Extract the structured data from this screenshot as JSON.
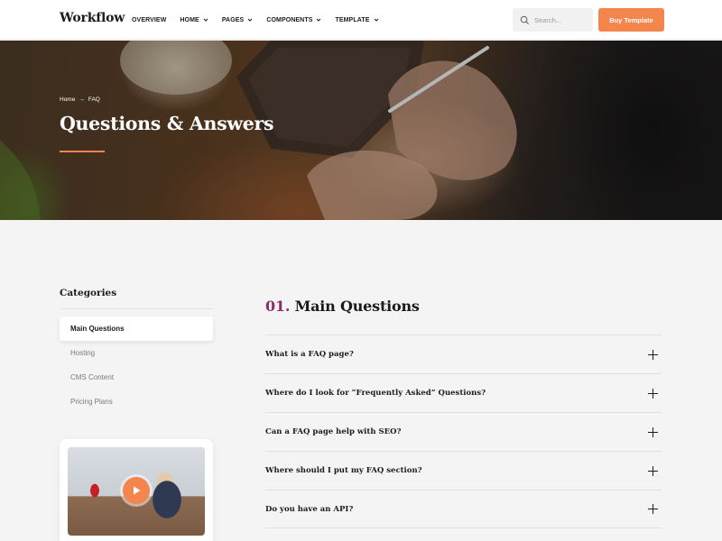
{
  "header": {
    "logo": "Workflow",
    "nav": [
      {
        "label": "OVERVIEW",
        "has_dropdown": false
      },
      {
        "label": "HOME",
        "has_dropdown": true
      },
      {
        "label": "PAGES",
        "has_dropdown": true
      },
      {
        "label": "COMPONENTS",
        "has_dropdown": true
      },
      {
        "label": "TEMPLATE",
        "has_dropdown": true
      }
    ],
    "search_placeholder": "Search...",
    "buy_label": "Buy Template"
  },
  "hero": {
    "breadcrumb": {
      "home": "Home",
      "separator": "→",
      "current": "FAQ"
    },
    "title": "Questions & Answers"
  },
  "sidebar": {
    "title": "Categories",
    "items": [
      {
        "label": "Main Questions",
        "active": true
      },
      {
        "label": "Hosting",
        "active": false
      },
      {
        "label": "CMS Content",
        "active": false
      },
      {
        "label": "Pricing Plans",
        "active": false
      }
    ]
  },
  "main": {
    "section_number": "01.",
    "section_title": "Main Questions",
    "faqs": [
      {
        "question": "What is a FAQ page?"
      },
      {
        "question": "Where do I look for “Frequently Asked” Questions?"
      },
      {
        "question": "Can a FAQ page help with SEO?"
      },
      {
        "question": "Where should I put my FAQ section?"
      },
      {
        "question": "Do you have an API?"
      }
    ]
  },
  "colors": {
    "accent": "#f4854c",
    "section_number": "#8a2e6b",
    "page_background": "#f4f4f4"
  },
  "icons": {
    "search": "search-icon",
    "dropdown": "chevron-down-icon",
    "play": "play-icon",
    "expand": "plus-icon"
  }
}
